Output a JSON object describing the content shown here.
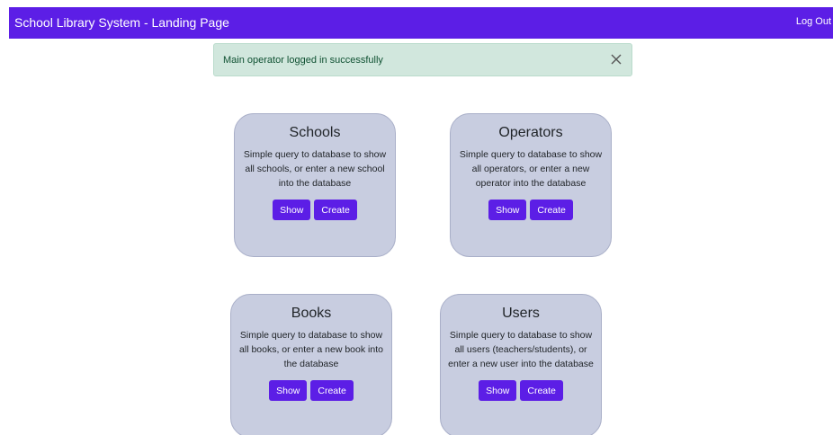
{
  "navbar": {
    "brand": "School Library System - Landing Page",
    "logout_label": "Log Out"
  },
  "alert": {
    "message": "Main operator logged in successfully",
    "close_icon": "close-icon"
  },
  "colors": {
    "accent": "#5c1ee6",
    "card_bg": "#c8cde0",
    "alert_bg": "#d1e7dd"
  },
  "cards": [
    {
      "title": "Schools",
      "description": "Simple query to database to show all schools, or enter a new school into the database",
      "show_label": "Show",
      "create_label": "Create"
    },
    {
      "title": "Operators",
      "description": "Simple query to database to show all operators, or enter a new operator into the database",
      "show_label": "Show",
      "create_label": "Create"
    },
    {
      "title": "Books",
      "description": "Simple query to database to show all books, or enter a new book into the database",
      "show_label": "Show",
      "create_label": "Create"
    },
    {
      "title": "Users",
      "description": "Simple query to database to show all users (teachers/students), or enter a new user into the database",
      "show_label": "Show",
      "create_label": "Create"
    }
  ]
}
